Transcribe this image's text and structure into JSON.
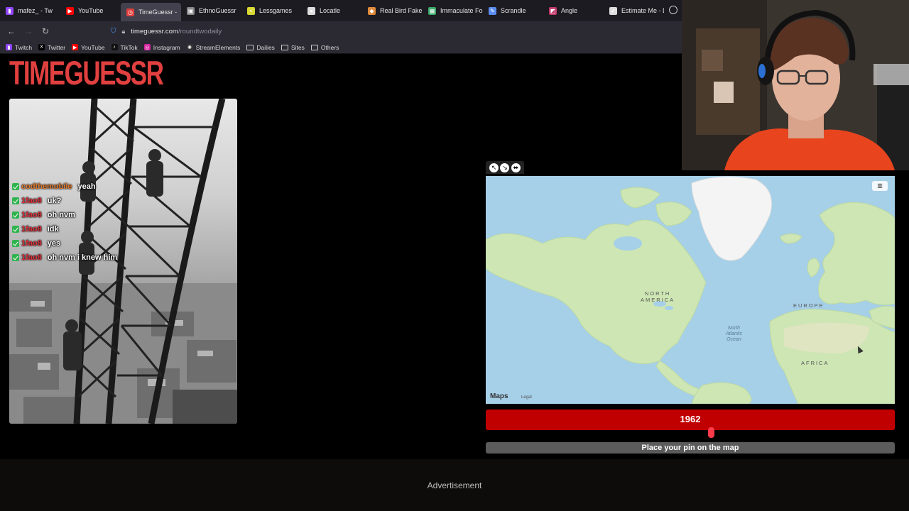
{
  "browser": {
    "tabs": [
      {
        "label": "mafez_ - Tw",
        "icon": "twitch-icon",
        "color": "#9146ff",
        "glyph": "▮"
      },
      {
        "label": "YouTube",
        "icon": "youtube-icon",
        "color": "#ff0000",
        "glyph": "▶"
      },
      {
        "label": "TimeGuessr -",
        "icon": "timeguessr-icon",
        "color": "#e0403f",
        "glyph": "◷",
        "active": true
      },
      {
        "label": "EthnoGuessr",
        "icon": "ethnoguessr-icon",
        "color": "#888888",
        "glyph": "▣"
      },
      {
        "label": "Lessgames",
        "icon": "lessgames-icon",
        "color": "#d8d832",
        "glyph": "<"
      },
      {
        "label": "Locatle",
        "icon": "locatle-icon",
        "color": "#dddddd",
        "glyph": "●"
      },
      {
        "label": "Real Bird Fake B",
        "icon": "bird-icon",
        "color": "#e08a3a",
        "glyph": "◆"
      },
      {
        "label": "Immaculate Foo",
        "icon": "grid-icon",
        "color": "#3aa86a",
        "glyph": "▦"
      },
      {
        "label": "Scrandle",
        "icon": "scrandle-icon",
        "color": "#5b8def",
        "glyph": "✎"
      },
      {
        "label": "Angle",
        "icon": "angle-icon",
        "color": "#c0396b",
        "glyph": "◩"
      },
      {
        "label": "Estimate Me - D",
        "icon": "estimate-icon",
        "color": "#dddddd",
        "glyph": "✔"
      }
    ],
    "url_host": "timeguessr.com",
    "url_path": "/roundtwodaily",
    "bookmarks": [
      {
        "label": "Twitch",
        "icon": "twitch-icon",
        "color": "#9146ff",
        "glyph": "▮"
      },
      {
        "label": "Twitter",
        "icon": "x-icon",
        "color": "#000000",
        "glyph": "X"
      },
      {
        "label": "YouTube",
        "icon": "youtube-icon",
        "color": "#ff0000",
        "glyph": "▶"
      },
      {
        "label": "TikTok",
        "icon": "tiktok-icon",
        "color": "#111111",
        "glyph": "♪"
      },
      {
        "label": "Instagram",
        "icon": "instagram-icon",
        "color": "#d6249f",
        "glyph": "◎"
      },
      {
        "label": "StreamElements",
        "icon": "streamelements-icon",
        "color": "#333333",
        "glyph": "✺"
      },
      {
        "label": "Dailies",
        "icon": "folder-icon",
        "folder": true
      },
      {
        "label": "Sites",
        "icon": "folder-icon",
        "folder": true
      },
      {
        "label": "Others",
        "icon": "folder-icon",
        "folder": true
      }
    ]
  },
  "page": {
    "logo": "TIMEGUESSR",
    "logo_color": "#e0403f",
    "year": "1962",
    "year_fraction": 0.55,
    "place_pin_label": "Place your pin on the map",
    "advertisement": "Advertisement"
  },
  "chat": [
    {
      "user": "codthemobile",
      "color": "#e07a2e",
      "msg": "yeah"
    },
    {
      "user": "1fao8",
      "color": "#e0303a",
      "msg": "uk?"
    },
    {
      "user": "1fao8",
      "color": "#e0303a",
      "msg": "oh nvm"
    },
    {
      "user": "1fao8",
      "color": "#e0303a",
      "msg": "idk"
    },
    {
      "user": "1fao8",
      "color": "#e0303a",
      "msg": "yes"
    },
    {
      "user": "1fao8",
      "color": "#e0303a",
      "msg": "oh nvm i knew him"
    }
  ],
  "map": {
    "labels": {
      "north_america": "NORTH\nAMERICA",
      "europe": "EUROPE",
      "africa": "AFRICA",
      "ocean": "North\nAtlantic\nOcean"
    },
    "attribution": " Maps",
    "legal": "Legal",
    "land_color": "#cde6b4",
    "water_color": "#a6cfe8"
  }
}
